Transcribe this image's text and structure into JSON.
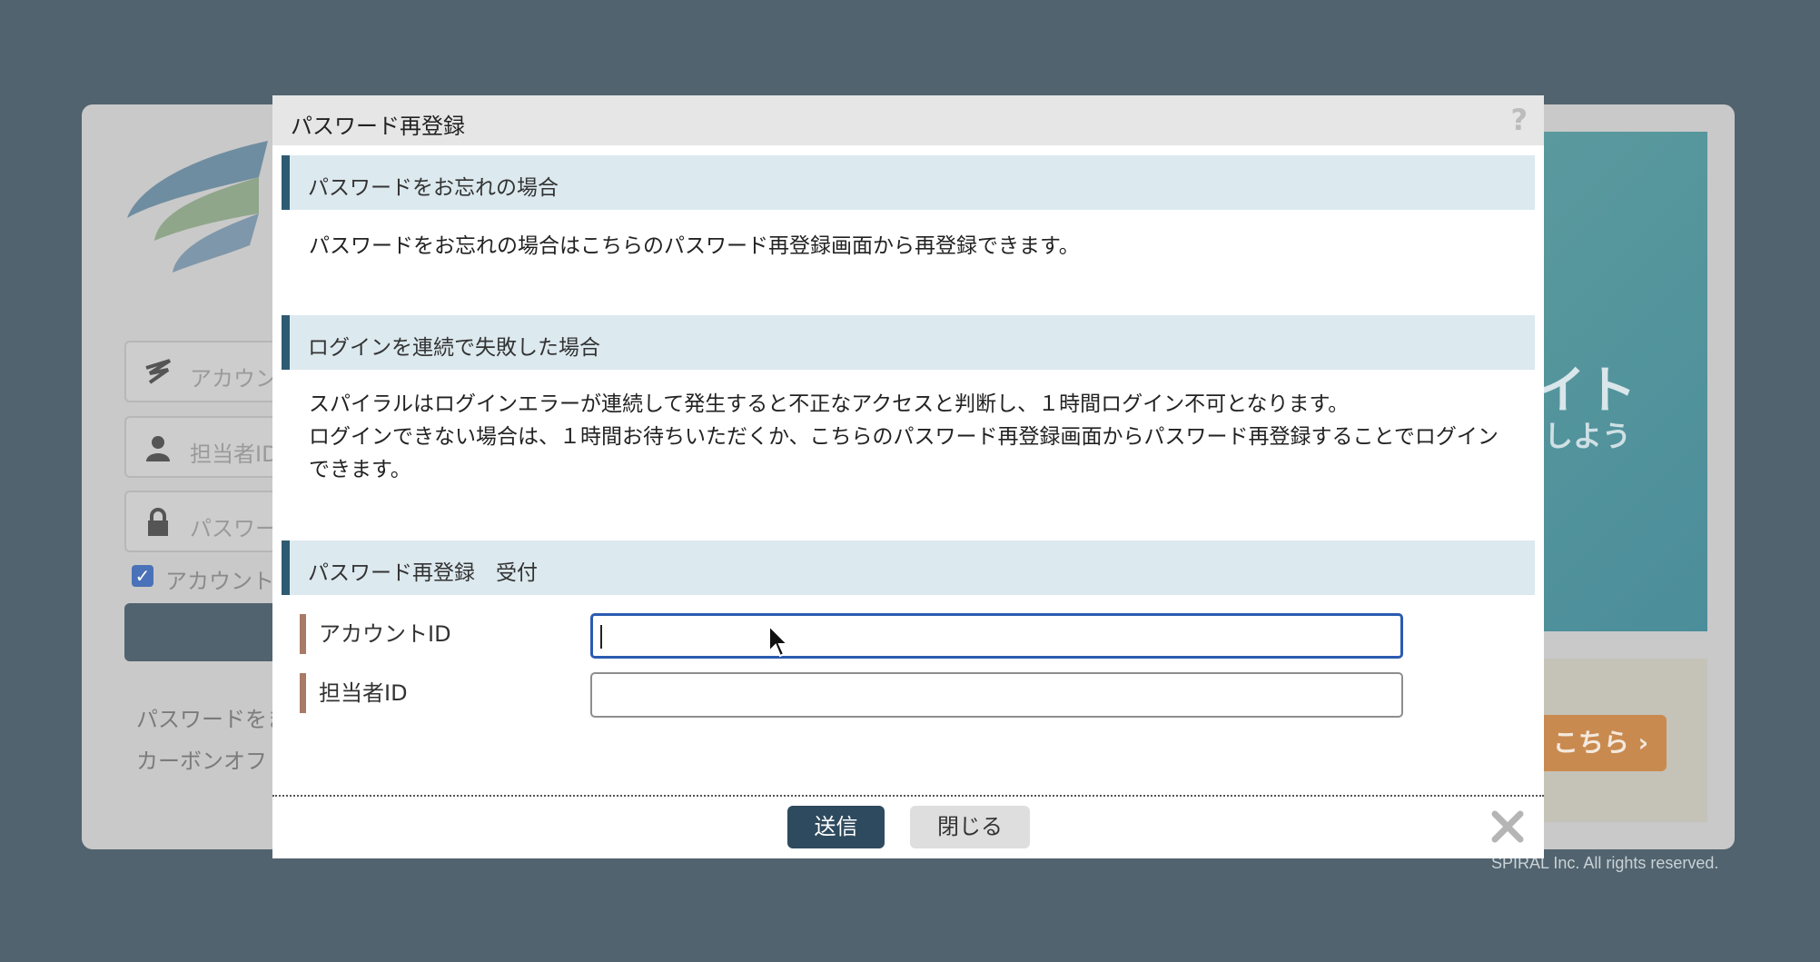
{
  "background": {
    "login": {
      "account_placeholder": "アカウン",
      "user_placeholder": "担当者ID",
      "password_placeholder": "パスワー",
      "remember_label": "アカウント",
      "link_forgot": "パスワードをま",
      "link_carbon": "カーボンオフ"
    },
    "banner": {
      "text1": "イト",
      "text2": "しよう",
      "button": "こちら ›"
    },
    "copyright": "SPIRAL Inc. All rights reserved."
  },
  "modal": {
    "title": "パスワード再登録",
    "help": "?",
    "sections": [
      {
        "heading": "パスワードをお忘れの場合",
        "text": "パスワードをお忘れの場合はこちらのパスワード再登録画面から再登録できます。"
      },
      {
        "heading": "ログインを連続で失敗した場合",
        "line1": "スパイラルはログインエラーが連続して発生すると不正なアクセスと判断し、１時間ログイン不可となります。",
        "line2": "ログインできない場合は、１時間お待ちいただくか、こちらのパスワード再登録画面からパスワード再登録することでログインできます。"
      },
      {
        "heading": "パスワード再登録　受付"
      }
    ],
    "form": {
      "account_id_label": "アカウントID",
      "account_id_value": "",
      "user_id_label": "担当者ID",
      "user_id_value": ""
    },
    "buttons": {
      "send": "送信",
      "close": "閉じる"
    }
  }
}
